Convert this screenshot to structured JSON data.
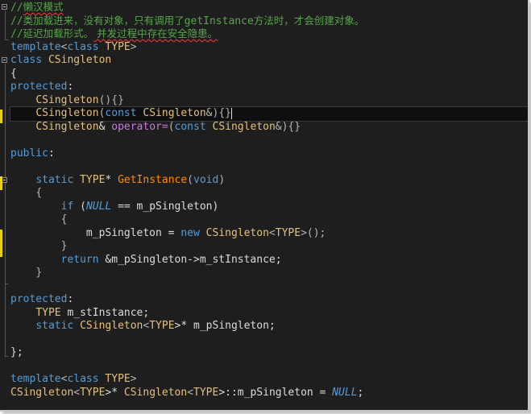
{
  "editor": {
    "colors": {
      "background": "#1e1e1e",
      "keyword": "#569cd6",
      "type": "#e5c07b",
      "function": "#ff8c00",
      "operator_keyword": "#c678dd",
      "comment": "#57a64a",
      "plain": "#dcdcdc",
      "change_marker": "#e6d21e",
      "squiggle": "#ff3c3c"
    },
    "lines": [
      {
        "t": [
          "//",
          "懒汉模式"
        ]
      },
      {
        "t": [
          "//",
          "类加载进来，没有对象，只有调用了",
          "getInstance",
          "方法时，才会创建对象。"
        ]
      },
      {
        "t": [
          "//",
          "延迟加载形式。",
          " 并发过程中存在安全隐患。"
        ]
      },
      {
        "t": [
          "template",
          "<",
          "class",
          " ",
          "TYPE",
          ">"
        ]
      },
      {
        "t": [
          "class",
          " ",
          "CSingleton"
        ]
      },
      {
        "t": [
          "{"
        ]
      },
      {
        "t": [
          "protected",
          ":"
        ]
      },
      {
        "t": [
          "    ",
          "CSingleton",
          "(){}"
        ]
      },
      {
        "t": [
          "    ",
          "CSingleton",
          "(",
          "const",
          " ",
          "CSingleton",
          "&){}"
        ]
      },
      {
        "t": [
          "    ",
          "CSingleton",
          "& ",
          "operator=",
          "(",
          "const",
          " ",
          "CSingleton",
          "&){}"
        ]
      },
      {
        "t": [
          ""
        ]
      },
      {
        "t": [
          "public",
          ":"
        ]
      },
      {
        "t": [
          ""
        ]
      },
      {
        "t": [
          "    ",
          "static",
          " ",
          "TYPE",
          "* ",
          "GetInstance",
          "(",
          "void",
          ")"
        ]
      },
      {
        "t": [
          "    ",
          "{"
        ]
      },
      {
        "t": [
          "        ",
          "if",
          " (",
          "NULL",
          " == m_pSingleton)"
        ]
      },
      {
        "t": [
          "        ",
          "{"
        ]
      },
      {
        "t": [
          "            m_pSingleton = ",
          "new",
          " ",
          "CSingleton",
          "<",
          "TYPE",
          ">();"
        ]
      },
      {
        "t": [
          "        ",
          "}"
        ]
      },
      {
        "t": [
          "        ",
          "return",
          " &m_pSingleton->m_stInstance;"
        ]
      },
      {
        "t": [
          "    ",
          "}"
        ]
      },
      {
        "t": [
          ""
        ]
      },
      {
        "t": [
          "protected",
          ":"
        ]
      },
      {
        "t": [
          "    ",
          "TYPE",
          " m_stInstance;"
        ]
      },
      {
        "t": [
          "    ",
          "static",
          " ",
          "CSingleton",
          "<",
          "TYPE",
          ">* m_pSingleton;"
        ]
      },
      {
        "t": [
          ""
        ]
      },
      {
        "t": [
          "};"
        ]
      },
      {
        "t": [
          ""
        ]
      },
      {
        "t": [
          "template",
          "<",
          "class",
          " ",
          "TYPE",
          ">"
        ]
      },
      {
        "t": [
          "CSingleton",
          "<",
          "TYPE",
          ">* ",
          "CSingleton",
          "<",
          "TYPE",
          ">::m_pSingleton = ",
          "NULL",
          ";"
        ]
      }
    ]
  }
}
